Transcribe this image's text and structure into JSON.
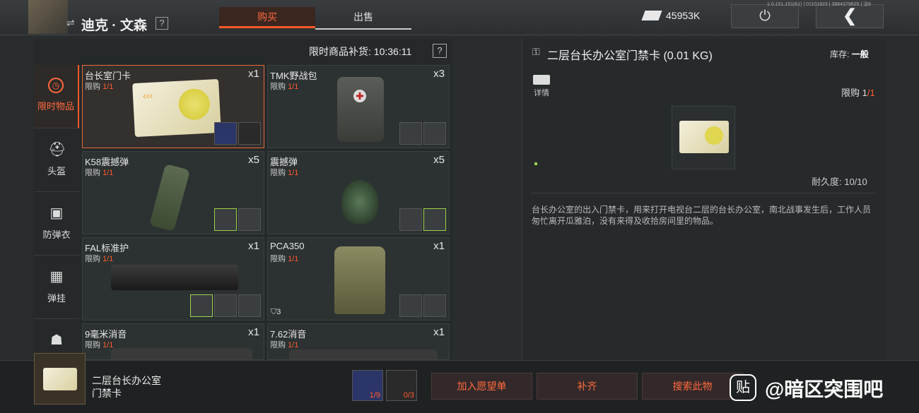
{
  "header": {
    "vendor_name": "迪克 · 文森",
    "help": "?",
    "tabs": {
      "buy": "购买",
      "sell": "出售"
    },
    "money": "45953K",
    "version": "1.0.151.151(61) | 01101923 | 3884379625 | 法6"
  },
  "sidebar": {
    "categories": [
      {
        "label": "限时物品",
        "icon": "clock-icon"
      },
      {
        "label": "头盔",
        "icon": "helmet-icon"
      },
      {
        "label": "防弹衣",
        "icon": "vest-icon"
      },
      {
        "label": "弹挂",
        "icon": "rig-icon"
      }
    ]
  },
  "list": {
    "restock_label": "限时商品补货: 10:36:11",
    "limit_prefix": "限购",
    "items": [
      {
        "name": "台长室门卡",
        "qty": "x1",
        "limit": "1/1"
      },
      {
        "name": "TMK野战包",
        "qty": "x3",
        "limit": "1/1"
      },
      {
        "name": "K58震撼弹",
        "qty": "x5",
        "limit": "1/1"
      },
      {
        "name": "震撼弹",
        "qty": "x5",
        "limit": "1/1"
      },
      {
        "name": "FAL标准护",
        "qty": "x1",
        "limit": "1/1"
      },
      {
        "name": "PCA350",
        "qty": "x1",
        "limit": "1/1",
        "armor": "3"
      },
      {
        "name": "9毫米消音",
        "qty": "x1",
        "limit": "1/1"
      },
      {
        "name": "7.62消音",
        "qty": "x1",
        "limit": "1/1"
      }
    ]
  },
  "detail": {
    "title": "二层台长办公室门禁卡 (0.01 KG)",
    "stock_label": "库存:",
    "stock_value": "一般",
    "detail_label": "详情",
    "limit_label": "限购",
    "limit_value": "1",
    "limit_total": "/1",
    "durability": "耐久度: 10/10",
    "description": "台长办公室的出入门禁卡，用来打开电视台二层的台长办公室，南北战事发生后，工作人员匆忙离开瓜雅泊，没有来得及收拾房间里的物品。"
  },
  "bottom": {
    "item_name": "二层台长办公室门禁卡",
    "slot1": "1/9",
    "slot2": "0/3",
    "wishlist": "加入愿望单",
    "restock": "补齐",
    "search": "搜索此物",
    "watermark": "@暗区突围吧",
    "watermark_icon": "贴"
  },
  "colors": {
    "accent": "#ff5a2a",
    "green": "#9bd04a"
  }
}
